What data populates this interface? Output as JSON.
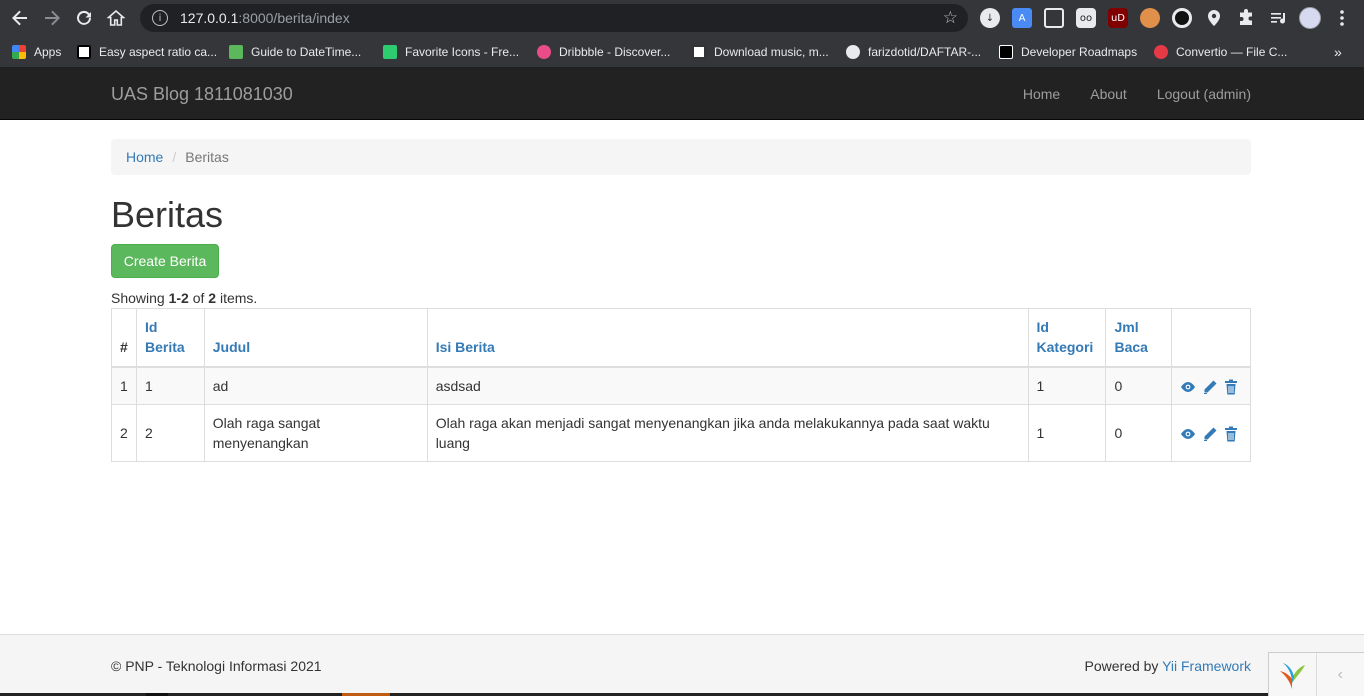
{
  "browser": {
    "url_host": "127.0.0.1",
    "url_path": ":8000/berita/index",
    "bookmarks": [
      "Apps",
      "Easy aspect ratio ca...",
      "Guide to DateTime...",
      "Favorite Icons - Fre...",
      "Dribbble - Discover...",
      "Download music, m...",
      "farizdotid/DAFTAR-...",
      "Developer Roadmaps",
      "Convertio — File C..."
    ],
    "ext_ud_label": "uD"
  },
  "navbar": {
    "brand": "UAS Blog 1811081030",
    "links": [
      "Home",
      "About",
      "Logout (admin)"
    ]
  },
  "breadcrumb": {
    "home": "Home",
    "separator": "/",
    "current": "Beritas"
  },
  "page": {
    "title": "Beritas",
    "create_button": "Create Berita",
    "summary_prefix": "Showing ",
    "summary_range": "1-2",
    "summary_mid": " of ",
    "summary_total": "2",
    "summary_suffix": " items."
  },
  "table": {
    "headers": {
      "num": "#",
      "id_berita_1": "Id",
      "id_berita_2": "Berita",
      "judul": "Judul",
      "isi_berita": "Isi Berita",
      "id_kategori_1": "Id",
      "id_kategori_2": "Kategori",
      "jml_baca_1": "Jml",
      "jml_baca_2": "Baca"
    },
    "rows": [
      {
        "num": "1",
        "id_berita": "1",
        "judul": "ad",
        "isi_berita": "asdsad",
        "id_kategori": "1",
        "jml_baca": "0"
      },
      {
        "num": "2",
        "id_berita": "2",
        "judul": "Olah raga sangat menyenangkan",
        "isi_berita": "Olah raga akan menjadi sangat menyenangkan jika anda melakukannya pada saat waktu luang",
        "id_kategori": "1",
        "jml_baca": "0"
      }
    ]
  },
  "footer": {
    "copyright": "© PNP - Teknologi Informasi 2021",
    "powered_prefix": "Powered by ",
    "powered_link": "Yii Framework"
  },
  "colors": {
    "link": "#337ab7",
    "success": "#5cb85c",
    "navbar_bg": "#222222"
  }
}
